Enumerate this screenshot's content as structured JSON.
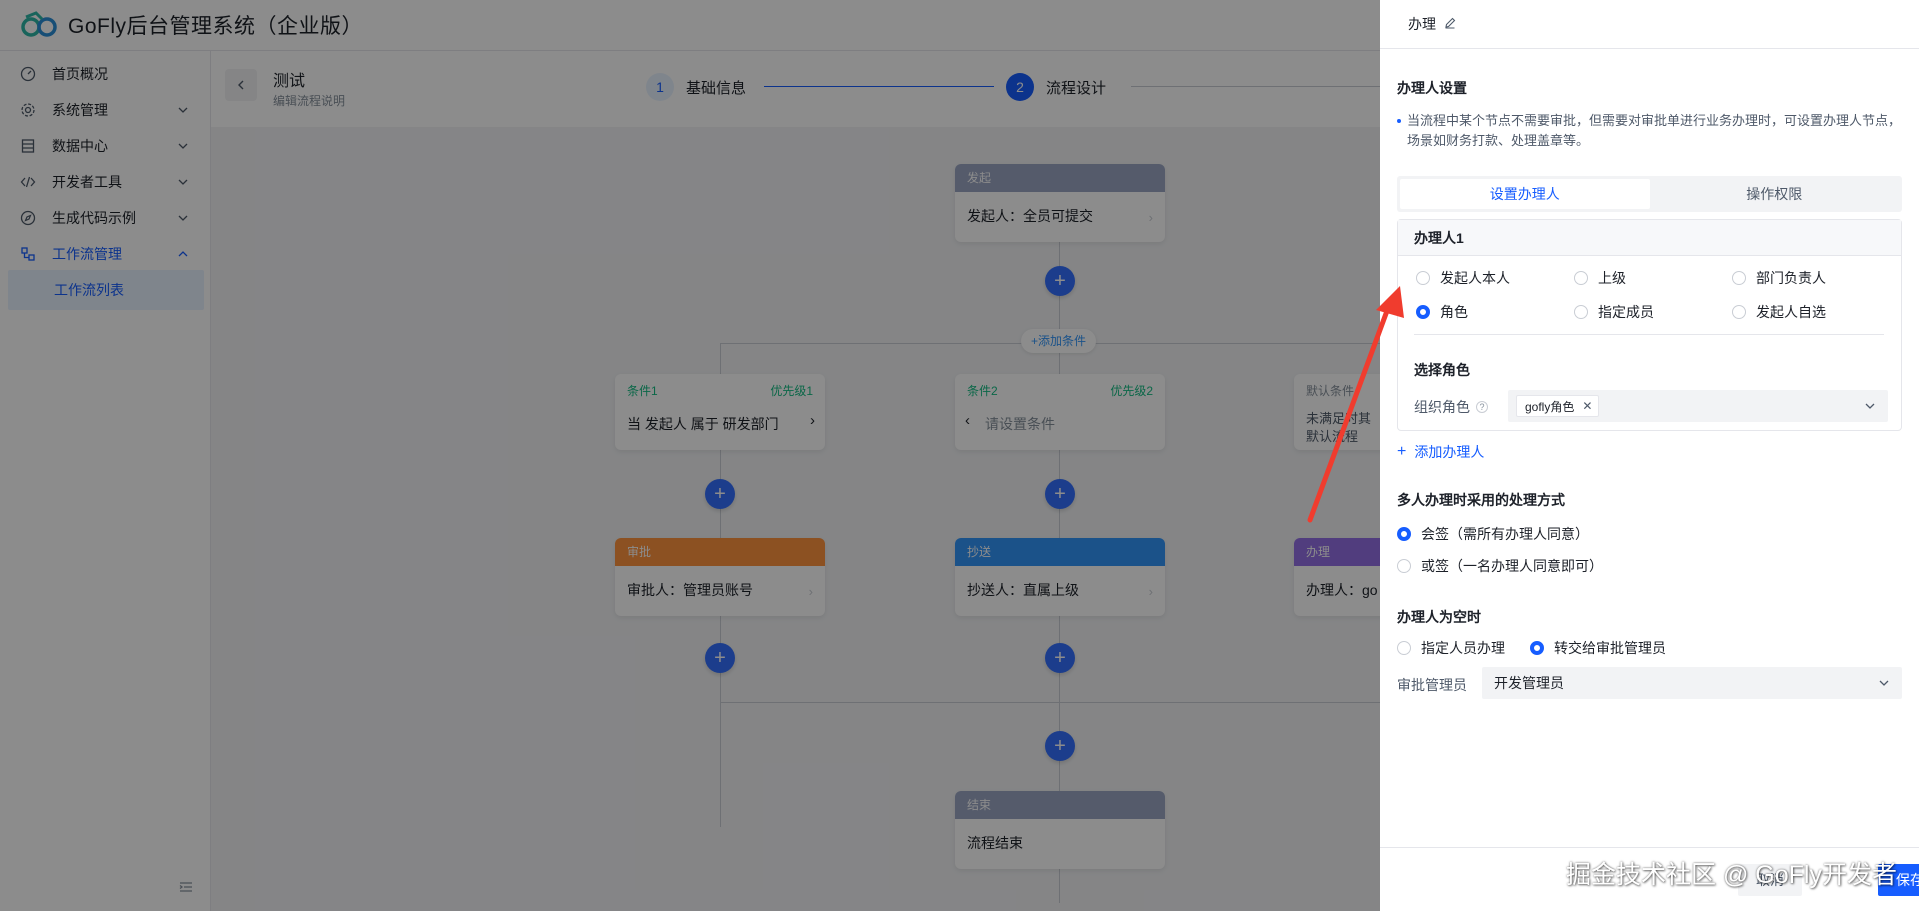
{
  "app": {
    "title": "GoFly后台管理系统（企业版）"
  },
  "sidebar": {
    "items": [
      {
        "label": "首页概况",
        "icon": "dashboard-icon"
      },
      {
        "label": "系统管理",
        "icon": "gear-icon"
      },
      {
        "label": "数据中心",
        "icon": "database-icon"
      },
      {
        "label": "开发者工具",
        "icon": "code-icon"
      },
      {
        "label": "生成代码示例",
        "icon": "compass-icon"
      },
      {
        "label": "工作流管理",
        "icon": "workflow-icon",
        "expanded": true
      }
    ],
    "active_sub": "工作流列表"
  },
  "page": {
    "flow_name": "测试",
    "flow_desc": "编辑流程说明"
  },
  "steps": [
    {
      "num": "1",
      "label": "基础信息"
    },
    {
      "num": "2",
      "label": "流程设计"
    }
  ],
  "flow": {
    "start": {
      "header": "发起",
      "body": "发起人：全员可提交"
    },
    "add_condition": "+添加条件",
    "conditions": [
      {
        "title": "条件1",
        "priority": "优先级1",
        "body": "当 发起人 属于 研发部门"
      },
      {
        "title": "条件2",
        "priority": "优先级2",
        "body": "请设置条件"
      },
      {
        "title": "默认条件",
        "body_line1": "未满足时其",
        "body_line2": "默认流程"
      }
    ],
    "approve": {
      "header": "审批",
      "body": "审批人：管理员账号"
    },
    "cc": {
      "header": "抄送",
      "body": "抄送人：直属上级"
    },
    "handle": {
      "header": "办理",
      "body": "办理人：go"
    },
    "end": {
      "header": "结束",
      "body": "流程结束"
    }
  },
  "drawer": {
    "title": "办理",
    "section_handler": "办理人设置",
    "hint": "当流程中某个节点不需要审批，但需要对审批单进行业务办理时，可设置办理人节点，场景如财务打款、处理盖章等。",
    "tabs": [
      "设置办理人",
      "操作权限"
    ],
    "handler_card_title": "办理人1",
    "handler_options": [
      {
        "label": "发起人本人",
        "checked": false
      },
      {
        "label": "上级",
        "checked": false
      },
      {
        "label": "部门负责人",
        "checked": false
      },
      {
        "label": "角色",
        "checked": true
      },
      {
        "label": "指定成员",
        "checked": false
      },
      {
        "label": "发起人自选",
        "checked": false
      }
    ],
    "select_role_title": "选择角色",
    "role_label": "组织角色",
    "role_tag": "gofly角色",
    "add_handler": "添加办理人",
    "multi_title": "多人办理时采用的处理方式",
    "multi_options": [
      {
        "label": "会签（需所有办理人同意）",
        "checked": true
      },
      {
        "label": "或签（一名办理人同意即可）",
        "checked": false
      }
    ],
    "empty_title": "办理人为空时",
    "empty_options": [
      {
        "label": "指定人员办理",
        "checked": false
      },
      {
        "label": "转交给审批管理员",
        "checked": true
      }
    ],
    "admin_label": "审批管理员",
    "admin_value": "开发管理员",
    "cancel": "取消",
    "save": "保存"
  },
  "watermark": "掘金技术社区 @ GoFly开发者",
  "colors": {
    "primary": "#165dff",
    "start_header": "#9ba6c3",
    "approve_header": "#ff943e",
    "cc_header": "#3296fa",
    "handle_header": "#9470e6",
    "condition_text": "#15bc83",
    "annotation_arrow": "#f03c2e"
  }
}
